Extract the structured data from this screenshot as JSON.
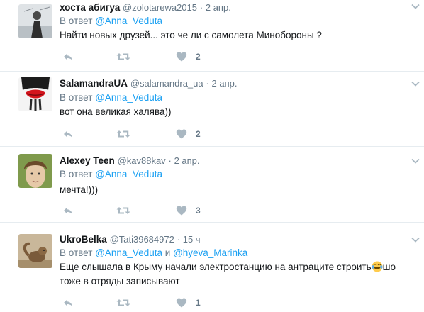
{
  "tweets": [
    {
      "name": "хоста абигуа",
      "handle": "@zolotarewa2015",
      "sep": "·",
      "date": "2 апр.",
      "reply_prefix": "В ответ",
      "mentions": [
        "@Anna_Veduta"
      ],
      "text": "Найти новых друзей... это че ли с самолета Минобороны ?",
      "likes": "2"
    },
    {
      "name": "SalamandraUA",
      "handle": "@salamandra_ua",
      "sep": "·",
      "date": "2 апр.",
      "reply_prefix": "В ответ",
      "mentions": [
        "@Anna_Veduta"
      ],
      "text": "вот она великая халява))",
      "likes": "2"
    },
    {
      "name": "Alexey Teen",
      "handle": "@kav88kav",
      "sep": "·",
      "date": "2 апр.",
      "reply_prefix": "В ответ",
      "mentions": [
        "@Anna_Veduta"
      ],
      "text": "мечта!)))",
      "likes": "3"
    },
    {
      "name": "UkroBelka",
      "handle": "@Tati39684972",
      "sep": "·",
      "date": "15 ч",
      "reply_prefix": "В ответ",
      "mentions": [
        "@Anna_Veduta",
        "@hyeva_Marinka"
      ],
      "mention_joiner": "и",
      "text_before_emoji": "Еще слышала в Крыму начали электростанцию на антраците строить",
      "text_after_emoji": "шо",
      "text_line2": "тоже в отряды записывают",
      "likes": "1"
    }
  ],
  "colors": {
    "link": "#1da1f2",
    "meta": "#657786",
    "icon": "#aab8c2",
    "divider": "#e6ecf0"
  },
  "icons": [
    "reply-icon",
    "retweet-icon",
    "like-icon",
    "chevron-down-icon",
    "tears-of-joy-emoji"
  ]
}
